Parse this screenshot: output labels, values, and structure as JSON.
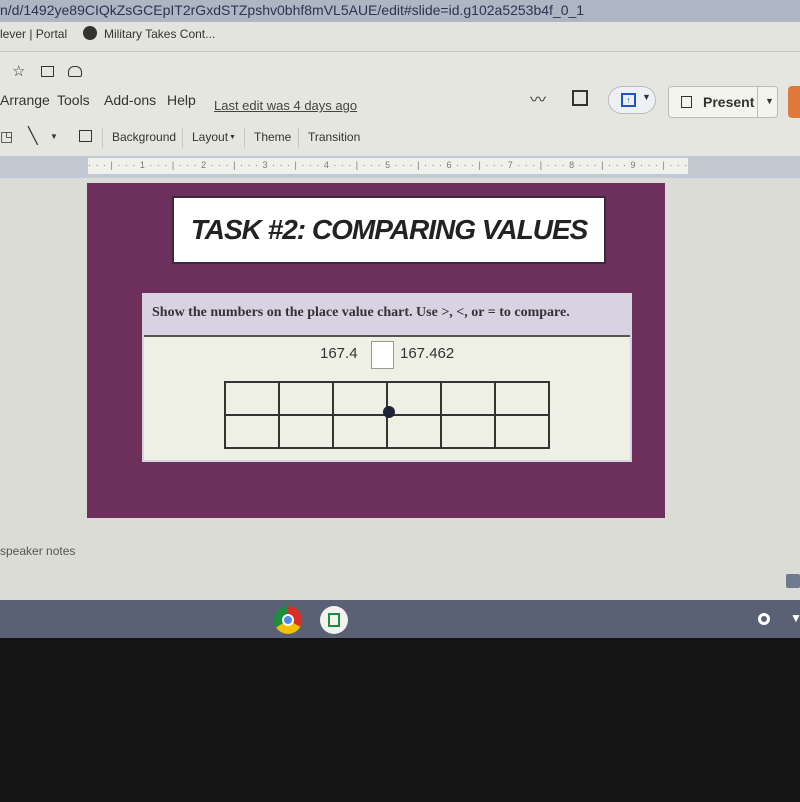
{
  "browser": {
    "url": "n/d/1492ye89CIQkZsGCEpIT2rGxdSTZpshv0bhf8mVL5AUE/edit#slide=id.g102a5253b4f_0_1",
    "bookmarks": [
      {
        "label": "lever | Portal"
      },
      {
        "label": "Military Takes Cont..."
      }
    ]
  },
  "menu": {
    "items": [
      "Arrange",
      "Tools",
      "Add-ons",
      "Help"
    ],
    "last_edit": "Last edit was 4 days ago",
    "present": "Present"
  },
  "toolbar": {
    "background": "Background",
    "layout": "Layout",
    "theme": "Theme",
    "transition": "Transition"
  },
  "ruler": {
    "marks": "· · · | · · · 1 · · · | · · · 2 · · · | · · · 3 · · · | · · · 4 · · · | · · · 5 · · · | · · · 6 · · · | · · · 7 · · · | · · · 8 · · · | · · · 9 · · · | · · ·"
  },
  "slide": {
    "title": "TASK #2: COMPARING VALUES",
    "instructions": "Show the numbers on the place value chart. Use >, <, or = to compare.",
    "left_number": "167.4",
    "right_number": "167.462",
    "comparison": "",
    "place_value_chart": {
      "columns": 6,
      "rows": 2
    },
    "colors": {
      "slide_bg": "#6d2f5b",
      "header_bg": "#d9d2e2"
    }
  },
  "notes": {
    "placeholder": "speaker notes"
  }
}
